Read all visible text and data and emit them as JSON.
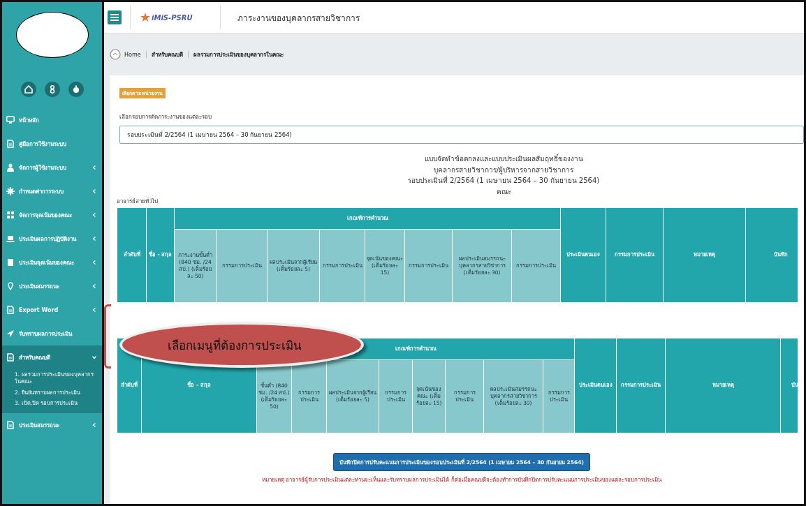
{
  "sidebar": {
    "items": [
      {
        "label": "หน้าหลัก",
        "kind": "link"
      },
      {
        "label": "คู่มือการใช้งานระบบ",
        "kind": "link"
      },
      {
        "label": "จัดการผู้ใช้งานระบบ",
        "kind": "group",
        "expanded": false
      },
      {
        "label": "กำหนดค่าการระบบ",
        "kind": "group",
        "expanded": false
      },
      {
        "label": "จัดการจุดเน้นของคณะ",
        "kind": "group",
        "expanded": false
      },
      {
        "label": "ประเมินผลการปฏิบัติงาน",
        "kind": "group",
        "expanded": false
      },
      {
        "label": "ประเมินจุดเน้นของคณะ",
        "kind": "group",
        "expanded": false
      },
      {
        "label": "ประเมินสมรรถนะ",
        "kind": "group",
        "expanded": false
      },
      {
        "label": "Export Word",
        "kind": "group",
        "expanded": false
      },
      {
        "label": "รับทราบผลการประเมิน",
        "kind": "link"
      },
      {
        "label": "สำหรับคณบดี",
        "kind": "group",
        "expanded": true,
        "children": [
          {
            "label": "1. ผลรวมการประเมินของบุคลากรในคณะ"
          },
          {
            "label": "2. ยืนยันทราบผลการประเมิน"
          },
          {
            "label": "3. เปิด,ปิด รอบการประเมิน"
          }
        ]
      },
      {
        "label": "ประเมินสมรรถนะ",
        "kind": "group",
        "expanded": false
      }
    ]
  },
  "header": {
    "logo": "iMiS-PSRU",
    "title": "ภาระงานของบุคลากรสายวิชาการ"
  },
  "breadcrumb": [
    "Home",
    "สำหรับคณบดี",
    "ผลรวมการประเมินของบุคลากรในคณะ"
  ],
  "badge": "เลือกตามหน่วยงาน",
  "round_select": {
    "label": "เลือกรอบการตัดภาระงานของแต่ละรอบ",
    "value": "รอบประเมินที่ 2/2564 (1 เมษายน 2564 – 30 กันยายน 2564)"
  },
  "form_title": [
    "แบบจัดทำข้อตกลงและแบบประเมินผลสัมฤทธิ์ของงาน",
    "บุคลากรสายวิชาการ/ผู้บริหารจากสายวิชาการ",
    "รอบประเมินที่ 2/2564 (1 เมษายน 2564 – 30 กันยายน 2564)",
    "คณะ"
  ],
  "tables": [
    {
      "section": "อาจารย์สายทั่วไป",
      "lead_columns": [
        "ลำดับที่",
        "ชื่อ - สกุล"
      ],
      "group_label": "เกณฑ์การคำนวณ",
      "sub_columns": [
        "ภาระงานขั้นต่ำ (840 ชม. /24 สป.) (เต็มร้อยละ 50)",
        "กรรมการประเมิน",
        "ผลประเมินจากผู้เรียน (เต็มร้อยละ 5)",
        "กรรมการประเมิน",
        "จุดเน้นของคณะ (เต็มร้อยละ 15)",
        "กรรมการประเมิน",
        "ผลประเมินสมรรถนะบุคลากรสายวิชาการ (เต็มร้อยละ 30)",
        "กรรมการประเมิน"
      ],
      "tail_columns": [
        "ประเมินตนเอง",
        "กรรมการประเมิน",
        "หมายเหตุ",
        "บันทึก"
      ]
    },
    {
      "lead_columns": [
        "ลำดับที่",
        "ชื่อ - สกุล"
      ],
      "group_label": "เกณฑ์การคำนวณ",
      "sub_columns": [
        "ขั้นต่ำ (840 ชม. /24 สป.) (เต็มร้อยละ 50)",
        "กรรมการประเมิน",
        "ผลประเมินจากผู้เรียน (เต็มร้อยละ 5)",
        "กรรมการประเมิน",
        "จุดเน้นของคณะ (เต็มร้อยละ 15)",
        "กรรมการประเมิน",
        "ผลประเมินสมรรถนะบุคลากรสายวิชาการ (เต็มร้อยละ 30)",
        "กรรมการประเมิน"
      ],
      "tail_columns": [
        "ประเมินตนเอง",
        "กรรมการประเมิน",
        "หมายเหตุ",
        "บัน"
      ]
    }
  ],
  "save_button": "บันทึกปิดการปรับคะแนนการประเมินของรอบประเมินที่ 2/2564 (1 เมษายน 2564 – 30 กันยายน 2564)",
  "note": "หมายเหตุ อาจารย์ผู้รับการประเมินแต่ละท่านจะเห็นและรับทราบผลการประเมินได้ ก็ต่อเมื่อคณบดีจะต้องทำการบันทึกปิดการปรับคะแนนการประเมินของแต่ละรอบการประเมิน",
  "callout": "เลือกเมนูที่ต้องการประเมิน"
}
